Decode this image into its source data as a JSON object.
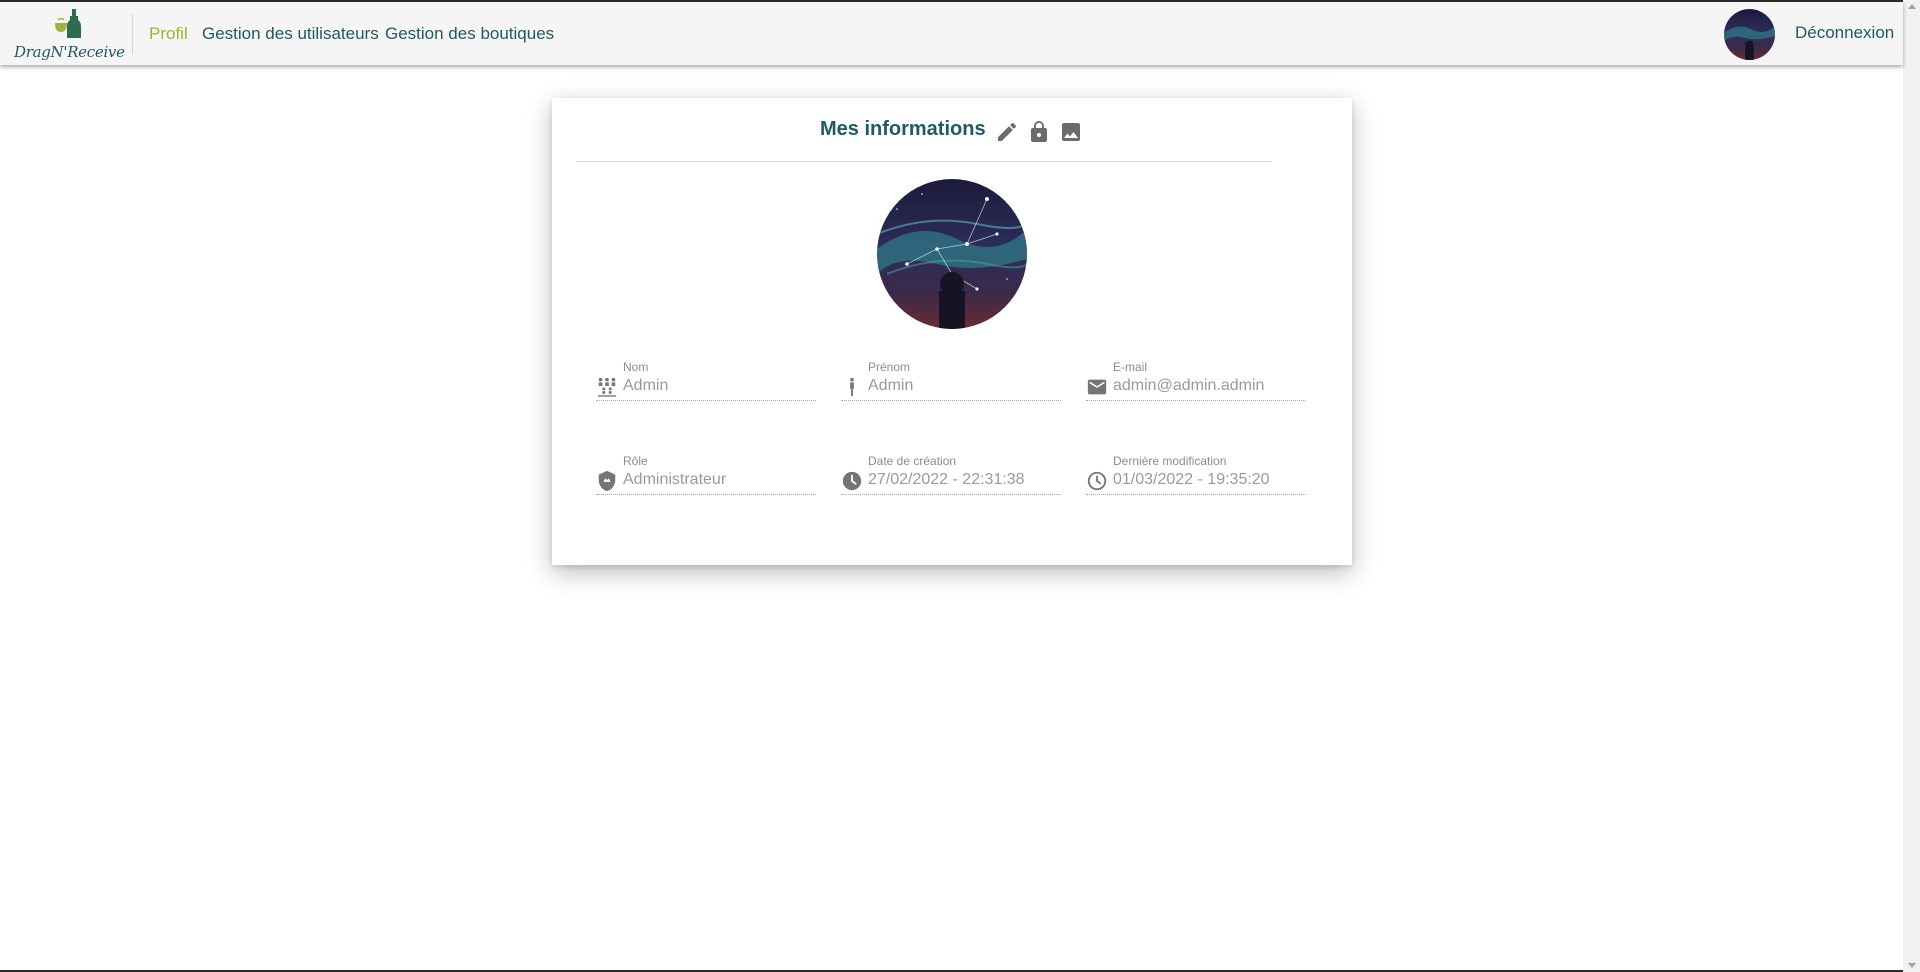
{
  "brand": {
    "name": "DragN'Receive"
  },
  "nav": {
    "items": [
      {
        "label": "Profil",
        "active": true
      },
      {
        "label": "Gestion des utilisateurs",
        "active": false
      },
      {
        "label": "Gestion des boutiques",
        "active": false
      }
    ],
    "logout_label": "Déconnexion"
  },
  "card": {
    "title": "Mes informations",
    "actions": [
      "pencil-icon",
      "lock-icon",
      "image-icon"
    ]
  },
  "fields": {
    "nom": {
      "label": "Nom",
      "value": "Admin",
      "icon": "family-icon"
    },
    "prenom": {
      "label": "Prénom",
      "value": "Admin",
      "icon": "person-icon"
    },
    "email": {
      "label": "E-mail",
      "value": "admin@admin.admin",
      "icon": "mail-icon"
    },
    "role": {
      "label": "Rôle",
      "value": "Administrateur",
      "icon": "shield-icon"
    },
    "created": {
      "label": "Date de création",
      "value": "27/02/2022 - 22:31:38",
      "icon": "clock-filled-icon"
    },
    "modified": {
      "label": "Dernière modification",
      "value": "01/03/2022 - 19:35:20",
      "icon": "clock-outline-icon"
    }
  },
  "colors": {
    "primary": "#1f5a5f",
    "accent": "#9fb23a",
    "navbar_bg": "#f5f5f5",
    "field_text": "#9a9a9a"
  }
}
